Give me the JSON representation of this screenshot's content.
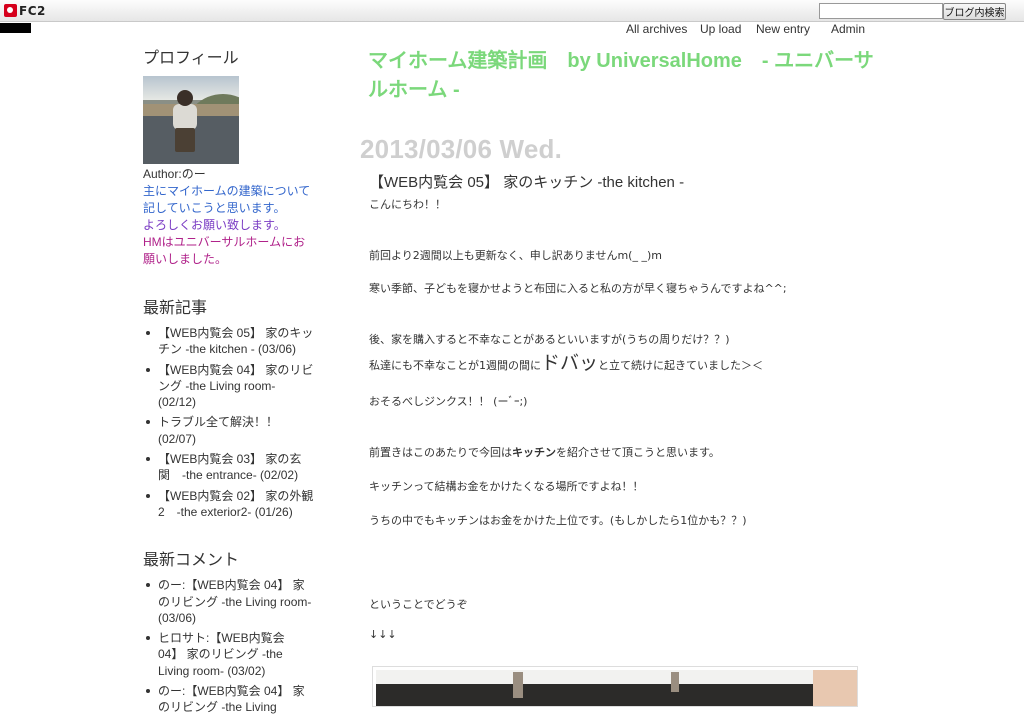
{
  "fc2bar": {
    "logo_text": "FC2",
    "search_placeholder": "",
    "search_button": "ブログ内検索"
  },
  "topnav": [
    "All archives",
    "Up load",
    "New entry",
    "Admin"
  ],
  "sidebar": {
    "profile": {
      "heading": "プロフィール",
      "author": "Author:のー",
      "desc1": "主にマイホームの建築について記していこうと思います。",
      "desc2": "よろしくお願い致します。",
      "desc3": "HMはユニバーサルホームにお願いしました。"
    },
    "recent_entries": {
      "heading": "最新記事",
      "items": [
        "【WEB内覧会 05】 家のキッチン -the kitchen - (03/06)",
        "【WEB内覧会 04】 家のリビング -the Living room- (02/12)",
        "トラブル全て解決！！ (02/07)",
        "【WEB内覧会 03】 家の玄関　-the entrance- (02/02)",
        "【WEB内覧会 02】 家の外観2　-the exterior2- (01/26)"
      ]
    },
    "recent_comments": {
      "heading": "最新コメント",
      "items": [
        "のー:【WEB内覧会 04】 家のリビング -the Living room- (03/06)",
        "ヒロサト:【WEB内覧会 04】 家のリビング -the Living room- (03/02)",
        "のー:【WEB内覧会 04】 家のリビング -the Living"
      ]
    }
  },
  "main": {
    "blog_title": "マイホーム建築計画　by UniversalHome　- ユニバーサルホーム -",
    "entry_date": "2013/03/06 Wed.",
    "entry_title": "【WEB内覧会 05】 家のキッチン -the kitchen -",
    "body": {
      "l1": "こんにちわ！！",
      "l2": "前回より2週間以上も更新なく、申し訳ありませんm(_ _)m",
      "l3": "寒い季節、子どもを寝かせようと布団に入ると私の方が早く寝ちゃうんですよね^^;",
      "l4": "後、家を購入すると不幸なことがあるといいますが(うちの周りだけ？？)",
      "l5a": "私達にも不幸なことが1週間の間に",
      "l5b": "ドバッ",
      "l5c": "と立て続けに起きていました＞＜",
      "l6": "おそるべしジンクス！！ (ーﾞｰ;)",
      "l7a": "前置きはこのあたりで今回は",
      "l7b": "キッチン",
      "l7c": "を紹介させて頂こうと思います。",
      "l8": "キッチンって結構お金をかけたくなる場所ですよね！！",
      "l9": "うちの中でもキッチンはお金をかけた上位です。(もしかしたら1位かも？？)",
      "l10": "ということでどうぞ",
      "l11": "↓↓↓"
    }
  },
  "colors": {
    "blog_title": "#7bd87b",
    "entry_date": "#cfcfcf",
    "link_blue": "#3366cc",
    "link_purple": "#7a3cc4",
    "link_magenta": "#b0228a"
  },
  "icons": [
    "fc2-logo-icon",
    "bullet-icon"
  ]
}
